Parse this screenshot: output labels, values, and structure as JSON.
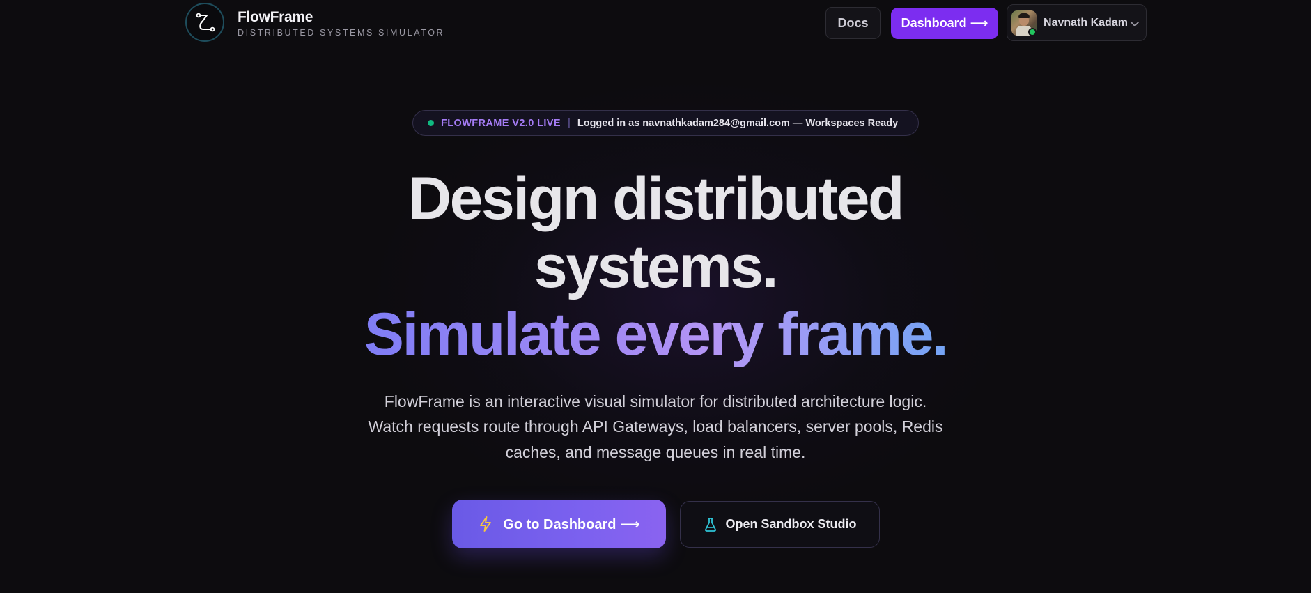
{
  "header": {
    "brand_name": "FlowFrame",
    "brand_subtitle": "DISTRIBUTED SYSTEMS SIMULATOR",
    "docs_label": "Docs",
    "dashboard_label": "Dashboard ⟶",
    "user": {
      "name": "Navnath Kadam",
      "status": "online"
    }
  },
  "banner": {
    "live_label": "FLOWFRAME V2.0 LIVE",
    "separator": "|",
    "message": "Logged in as navnathkadam284@gmail.com — Workspaces Ready"
  },
  "hero": {
    "line1": "Design distributed",
    "line2": "systems.",
    "line3": "Simulate every frame.",
    "description": [
      "FlowFrame is an interactive visual simulator for distributed architecture logic.",
      "Watch requests route through API Gateways, load balancers, server pools, Redis",
      "caches, and message queues in real time."
    ]
  },
  "cta": {
    "primary_label": "Go to Dashboard ⟶",
    "primary_icon": "lightning-icon",
    "secondary_label": "Open Sandbox Studio",
    "secondary_icon": "flask-icon"
  },
  "colors": {
    "background": "#0d0c0f",
    "accent_purple": "#7c2df0",
    "live_dot": "#10b981",
    "online_dot": "#22c55e",
    "gradient_start": "#7f7df5",
    "gradient_end": "#74a4f5"
  }
}
